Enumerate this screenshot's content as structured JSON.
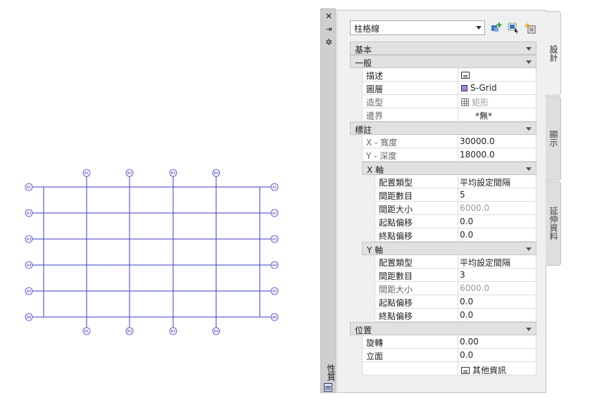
{
  "grid_bubbles": {
    "top": [
      "B1",
      "B2",
      "B3",
      "B4"
    ],
    "bottom": [
      "B1",
      "B2",
      "B3",
      "B4"
    ],
    "left": [
      "A1",
      "A2",
      "A3",
      "A4",
      "A5",
      "A6"
    ],
    "right": [
      "A1",
      "A2",
      "A3",
      "A4",
      "A5",
      "A6"
    ]
  },
  "palette": {
    "title": "性質",
    "close_glyph": "✕",
    "autohide_glyph": "⇥",
    "settings_glyph": "✲",
    "tabs": {
      "design": "設計",
      "display": "顯示",
      "extended": "延伸資料"
    },
    "style_selector": {
      "value": "柱格線"
    },
    "colors": {
      "layer_swatch": "#b57ee6",
      "grid_lines": "#3a3ac8"
    }
  },
  "categories": {
    "basic": "基本",
    "general": "一般",
    "dimensions": "標註",
    "x_axis": "X 軸",
    "y_axis": "Y 軸",
    "location": "位置"
  },
  "properties": {
    "general": [
      {
        "name": "描述",
        "value": ""
      },
      {
        "name": "圖層",
        "value": "S-Grid"
      },
      {
        "name": "造型",
        "value": "矩形"
      },
      {
        "name": "邊界",
        "value": "*無*"
      }
    ],
    "dimensions": [
      {
        "name": "X - 寬度",
        "value": "30000.0"
      },
      {
        "name": "Y - 深度",
        "value": "18000.0"
      }
    ],
    "x_axis": [
      {
        "name": "配置類型",
        "value": "平均設定間隔"
      },
      {
        "name": "間距數目",
        "value": "5"
      },
      {
        "name": "間距大小",
        "value": "6000.0"
      },
      {
        "name": "起點偏移",
        "value": "0.0"
      },
      {
        "name": "終點偏移",
        "value": "0.0"
      }
    ],
    "y_axis": [
      {
        "name": "配置類型",
        "value": "平均設定間隔"
      },
      {
        "name": "間距數目",
        "value": "3"
      },
      {
        "name": "間距大小",
        "value": "6000.0"
      },
      {
        "name": "起點偏移",
        "value": "0.0"
      },
      {
        "name": "終點偏移",
        "value": "0.0"
      }
    ],
    "location": [
      {
        "name": "旋轉",
        "value": "0.00"
      },
      {
        "name": "立面",
        "value": "0.0"
      },
      {
        "name": "",
        "value": "其他資訊"
      }
    ]
  }
}
